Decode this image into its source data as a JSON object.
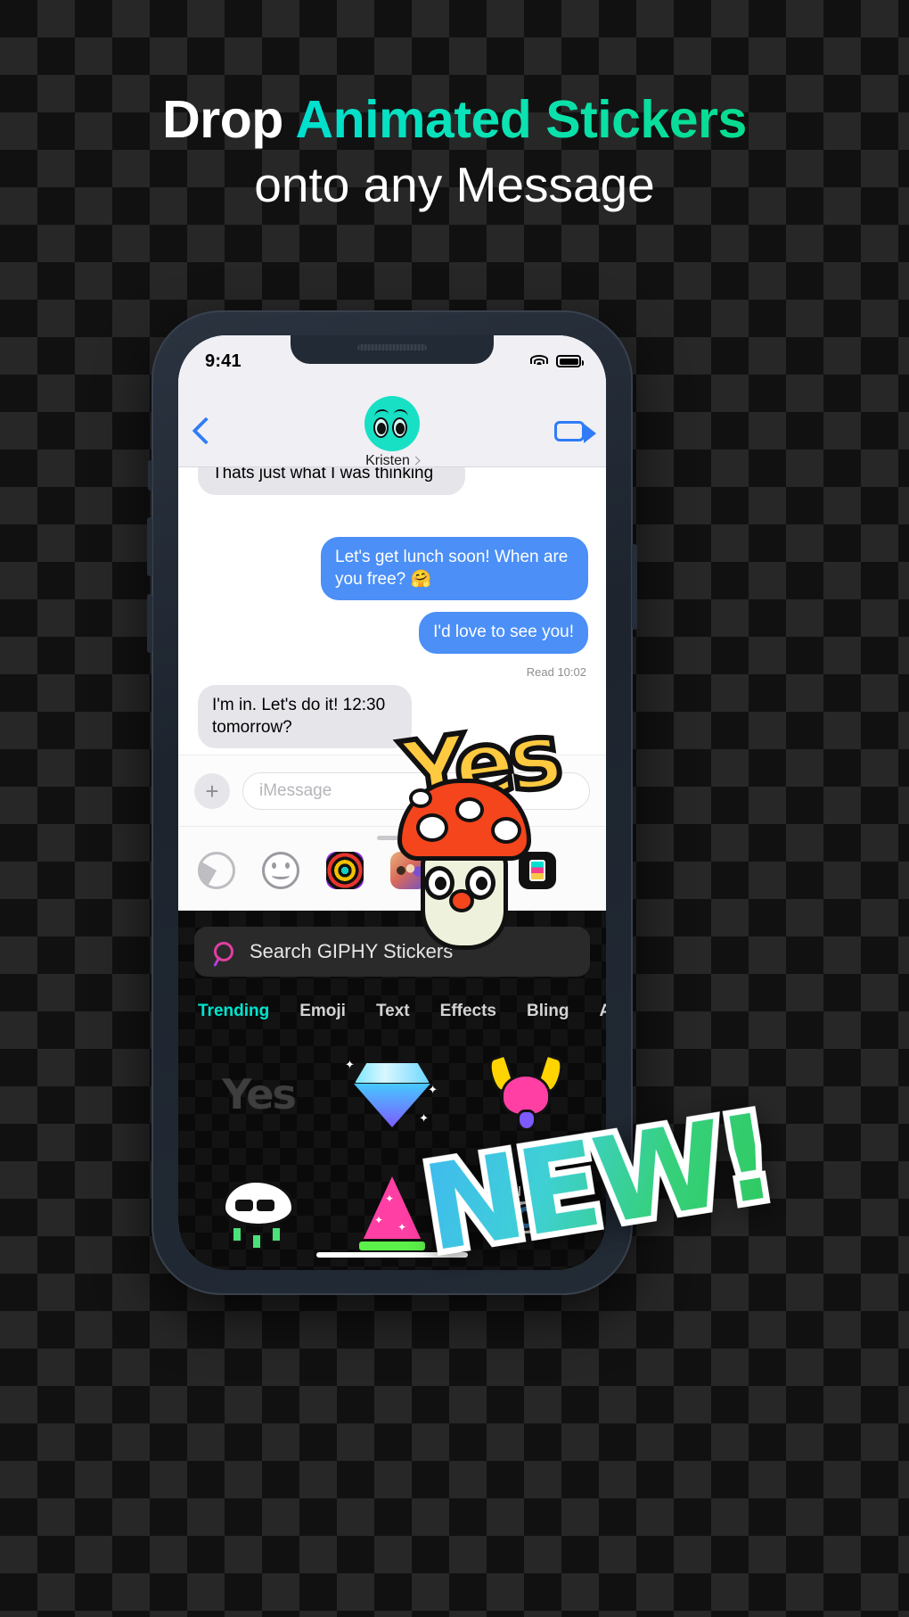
{
  "headline": {
    "line1_prefix": "Drop ",
    "line1_accent": "Animated Stickers",
    "line2": "onto any Message",
    "accent_color": "#0ce2b4"
  },
  "phone": {
    "status_bar": {
      "time": "9:41",
      "wifi_icon": "wifi-icon",
      "battery_icon": "battery-icon"
    },
    "contact_header": {
      "back_icon": "back-chevron-icon",
      "contact_name": "Kristen",
      "disclosure_icon": "chevron-right-icon",
      "facetime_icon": "video-camera-icon",
      "avatar_icon": "eyes-avatar",
      "avatar_color": "#18e0c4"
    },
    "conversation": {
      "messages": [
        {
          "text": "Thats just what I was thinking",
          "side": "in"
        },
        {
          "text": "Let's get lunch soon! When are you free? 🤗",
          "side": "out"
        },
        {
          "text": "I'd love to see you!",
          "side": "out"
        },
        {
          "text": "I'm in. Let's do it! 12:30 tomorrow?",
          "side": "in"
        }
      ],
      "read_receipt": "Read 10:02",
      "incoming_bubble_color": "#e6e5ea",
      "outgoing_bubble_color": "#4b8ff7"
    },
    "compose": {
      "add_label": "+",
      "placeholder": "iMessage"
    },
    "app_drawer": {
      "handle_icon": "drag-handle-icon",
      "apps": [
        "app-store-icon",
        "emoji-icon",
        "digital-touch-icon",
        "memoji-icon",
        "photos-icon",
        "giphy-icon"
      ]
    },
    "giphy": {
      "search_placeholder": "Search GIPHY Stickers",
      "search_icon": "magnifier-icon",
      "tabs": [
        {
          "label": "Trending",
          "active": true
        },
        {
          "label": "Emoji",
          "active": false
        },
        {
          "label": "Text",
          "active": false
        },
        {
          "label": "Effects",
          "active": false
        },
        {
          "label": "Bling",
          "active": false
        },
        {
          "label": "Accessories",
          "active": false
        }
      ],
      "active_tab_color": "#00e5d0",
      "stickers": [
        "yes-text-sticker",
        "diamond-sticker",
        "pink-horns-sticker",
        "money-cloud-sticker",
        "party-hat-sticker",
        "eyeball-sticker"
      ]
    },
    "home_indicator": "home-indicator"
  },
  "overlays": {
    "yes_sticker": {
      "text": "Yes",
      "character": "mushroom-character",
      "text_color": "#ffc940"
    },
    "new_badge": {
      "text": "NEW!",
      "color": "#34c8e8"
    }
  }
}
